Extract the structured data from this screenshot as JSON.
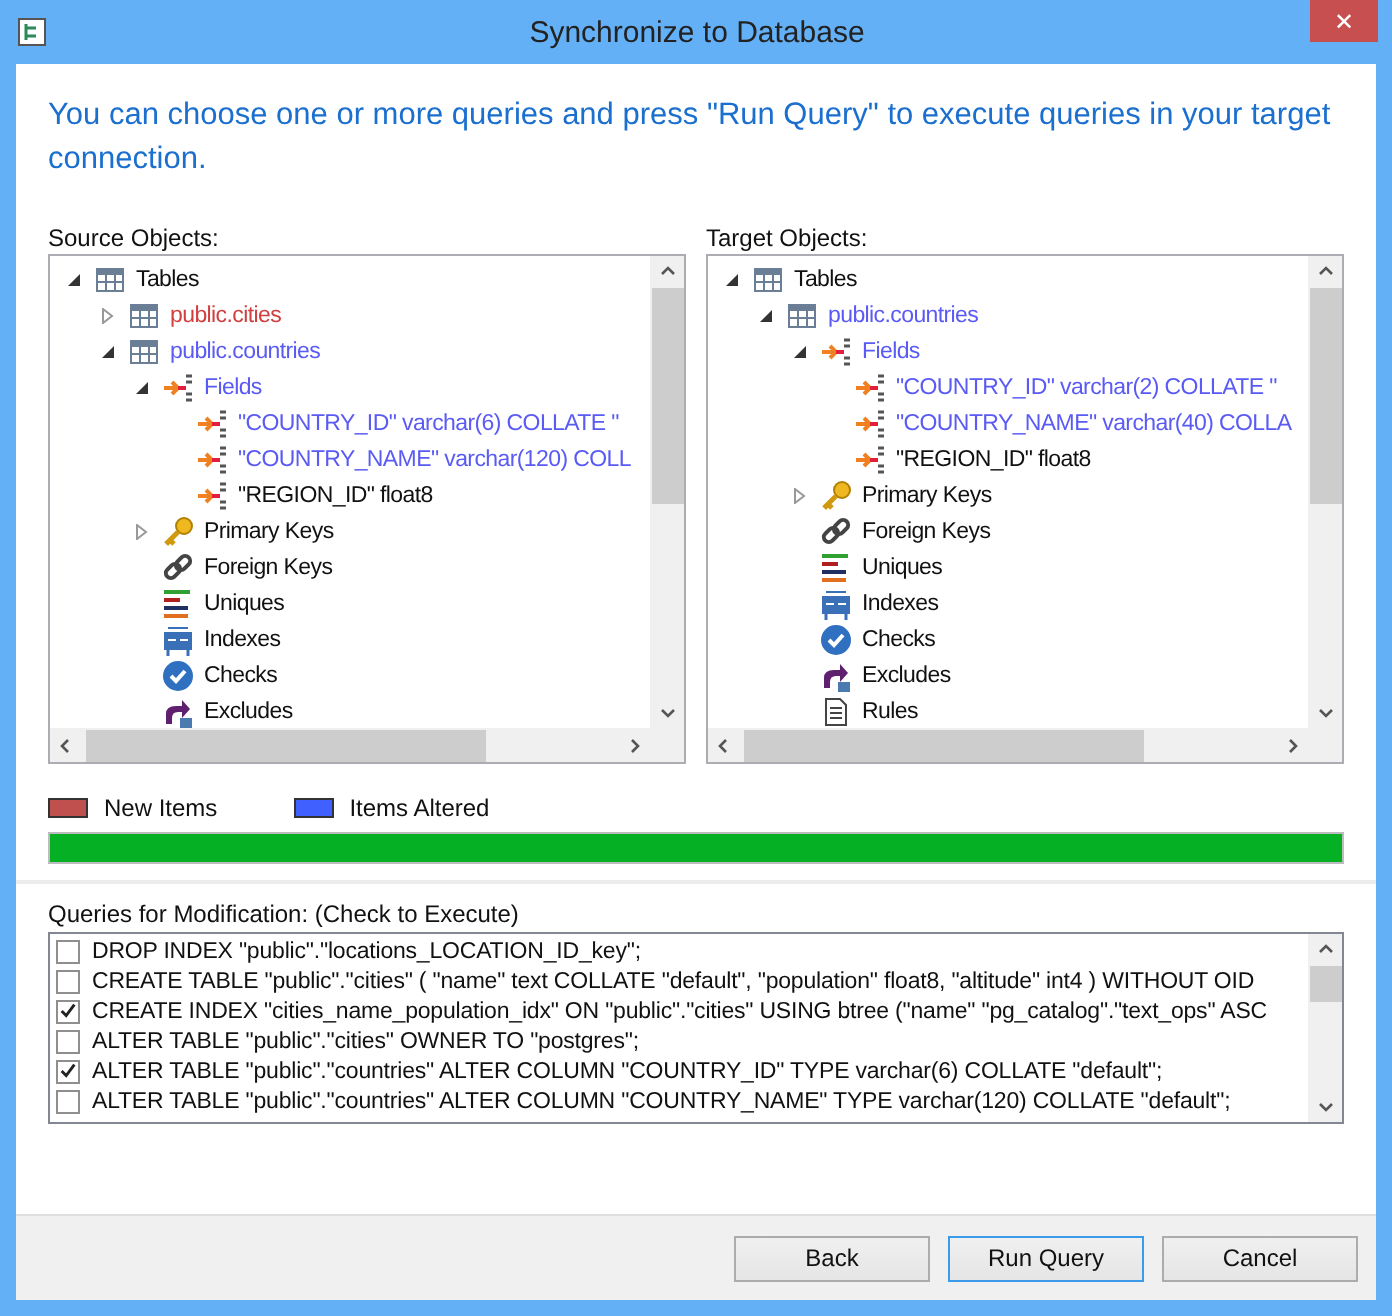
{
  "window": {
    "title": "Synchronize to Database",
    "close": "✕"
  },
  "intro": "You can choose one or more queries and press \"Run Query\" to execute queries in your target connection.",
  "panes": [
    {
      "label": "Source Objects:",
      "tree": [
        {
          "label": "Tables",
          "kind": "table",
          "new": false,
          "altered": false,
          "expanded": true,
          "children": [
            {
              "label": "public.cities",
              "kind": "table",
              "new": true,
              "altered": false,
              "expanded": false
            },
            {
              "label": "public.countries",
              "kind": "table",
              "new": false,
              "altered": true,
              "expanded": true,
              "children": [
                {
                  "label": "Fields",
                  "kind": "fields",
                  "new": false,
                  "altered": true,
                  "expanded": true,
                  "children": [
                    {
                      "label": "\"COUNTRY_ID\" varchar(6) COLLATE \"",
                      "kind": "field",
                      "new": false,
                      "altered": true
                    },
                    {
                      "label": "\"COUNTRY_NAME\" varchar(120) COLL",
                      "kind": "field",
                      "new": false,
                      "altered": true
                    },
                    {
                      "label": "\"REGION_ID\" float8",
                      "kind": "field",
                      "new": false,
                      "altered": false
                    }
                  ]
                },
                {
                  "label": "Primary Keys",
                  "kind": "pk",
                  "new": false,
                  "altered": false,
                  "expanded": false
                },
                {
                  "label": "Foreign Keys",
                  "kind": "fk",
                  "new": false,
                  "altered": false
                },
                {
                  "label": "Uniques",
                  "kind": "unique",
                  "new": false,
                  "altered": false
                },
                {
                  "label": "Indexes",
                  "kind": "index",
                  "new": false,
                  "altered": false
                },
                {
                  "label": "Checks",
                  "kind": "check",
                  "new": false,
                  "altered": false
                },
                {
                  "label": "Excludes",
                  "kind": "exclude",
                  "new": false,
                  "altered": false
                }
              ]
            }
          ]
        }
      ]
    },
    {
      "label": "Target Objects:",
      "tree": [
        {
          "label": "Tables",
          "kind": "table",
          "new": false,
          "altered": false,
          "expanded": true,
          "children": [
            {
              "label": "public.countries",
              "kind": "table",
              "new": false,
              "altered": true,
              "expanded": true,
              "children": [
                {
                  "label": "Fields",
                  "kind": "fields",
                  "new": false,
                  "altered": true,
                  "expanded": true,
                  "children": [
                    {
                      "label": "\"COUNTRY_ID\" varchar(2) COLLATE \"",
                      "kind": "field",
                      "new": false,
                      "altered": true
                    },
                    {
                      "label": "\"COUNTRY_NAME\" varchar(40) COLLA",
                      "kind": "field",
                      "new": false,
                      "altered": true
                    },
                    {
                      "label": "\"REGION_ID\" float8",
                      "kind": "field",
                      "new": false,
                      "altered": false
                    }
                  ]
                },
                {
                  "label": "Primary Keys",
                  "kind": "pk",
                  "new": false,
                  "altered": false,
                  "expanded": false
                },
                {
                  "label": "Foreign Keys",
                  "kind": "fk",
                  "new": false,
                  "altered": false
                },
                {
                  "label": "Uniques",
                  "kind": "unique",
                  "new": false,
                  "altered": false
                },
                {
                  "label": "Indexes",
                  "kind": "index",
                  "new": false,
                  "altered": false
                },
                {
                  "label": "Checks",
                  "kind": "check",
                  "new": false,
                  "altered": false
                },
                {
                  "label": "Excludes",
                  "kind": "exclude",
                  "new": false,
                  "altered": false
                },
                {
                  "label": "Rules",
                  "kind": "rule",
                  "new": false,
                  "altered": false
                }
              ]
            }
          ]
        }
      ]
    }
  ],
  "legend": [
    {
      "label": "New Items",
      "color": "#c0504d"
    },
    {
      "label": "Items Altered",
      "color": "#4060ff"
    }
  ],
  "progress": {
    "level": 1
  },
  "queries": {
    "label": "Queries for Modification: (Check to Execute)",
    "items": [
      {
        "text": "DROP INDEX \"public\".\"locations_LOCATION_ID_key\";",
        "checked": false
      },
      {
        "text": "CREATE TABLE \"public\".\"cities\" ( \"name\" text COLLATE \"default\", \"population\" float8, \"altitude\" int4 ) WITHOUT OID",
        "checked": false
      },
      {
        "text": "CREATE INDEX \"cities_name_population_idx\" ON \"public\".\"cities\" USING btree (\"name\" \"pg_catalog\".\"text_ops\" ASC",
        "checked": true
      },
      {
        "text": "ALTER TABLE \"public\".\"cities\" OWNER TO \"postgres\";",
        "checked": false
      },
      {
        "text": "ALTER TABLE \"public\".\"countries\" ALTER COLUMN \"COUNTRY_ID\" TYPE varchar(6) COLLATE \"default\";",
        "checked": true
      },
      {
        "text": "ALTER TABLE \"public\".\"countries\" ALTER COLUMN \"COUNTRY_NAME\" TYPE varchar(120) COLLATE \"default\";",
        "checked": false
      }
    ]
  },
  "buttons": [
    {
      "label": "Back",
      "focused": false
    },
    {
      "label": "Run Query",
      "focused": true
    },
    {
      "label": "Cancel",
      "focused": false
    }
  ]
}
